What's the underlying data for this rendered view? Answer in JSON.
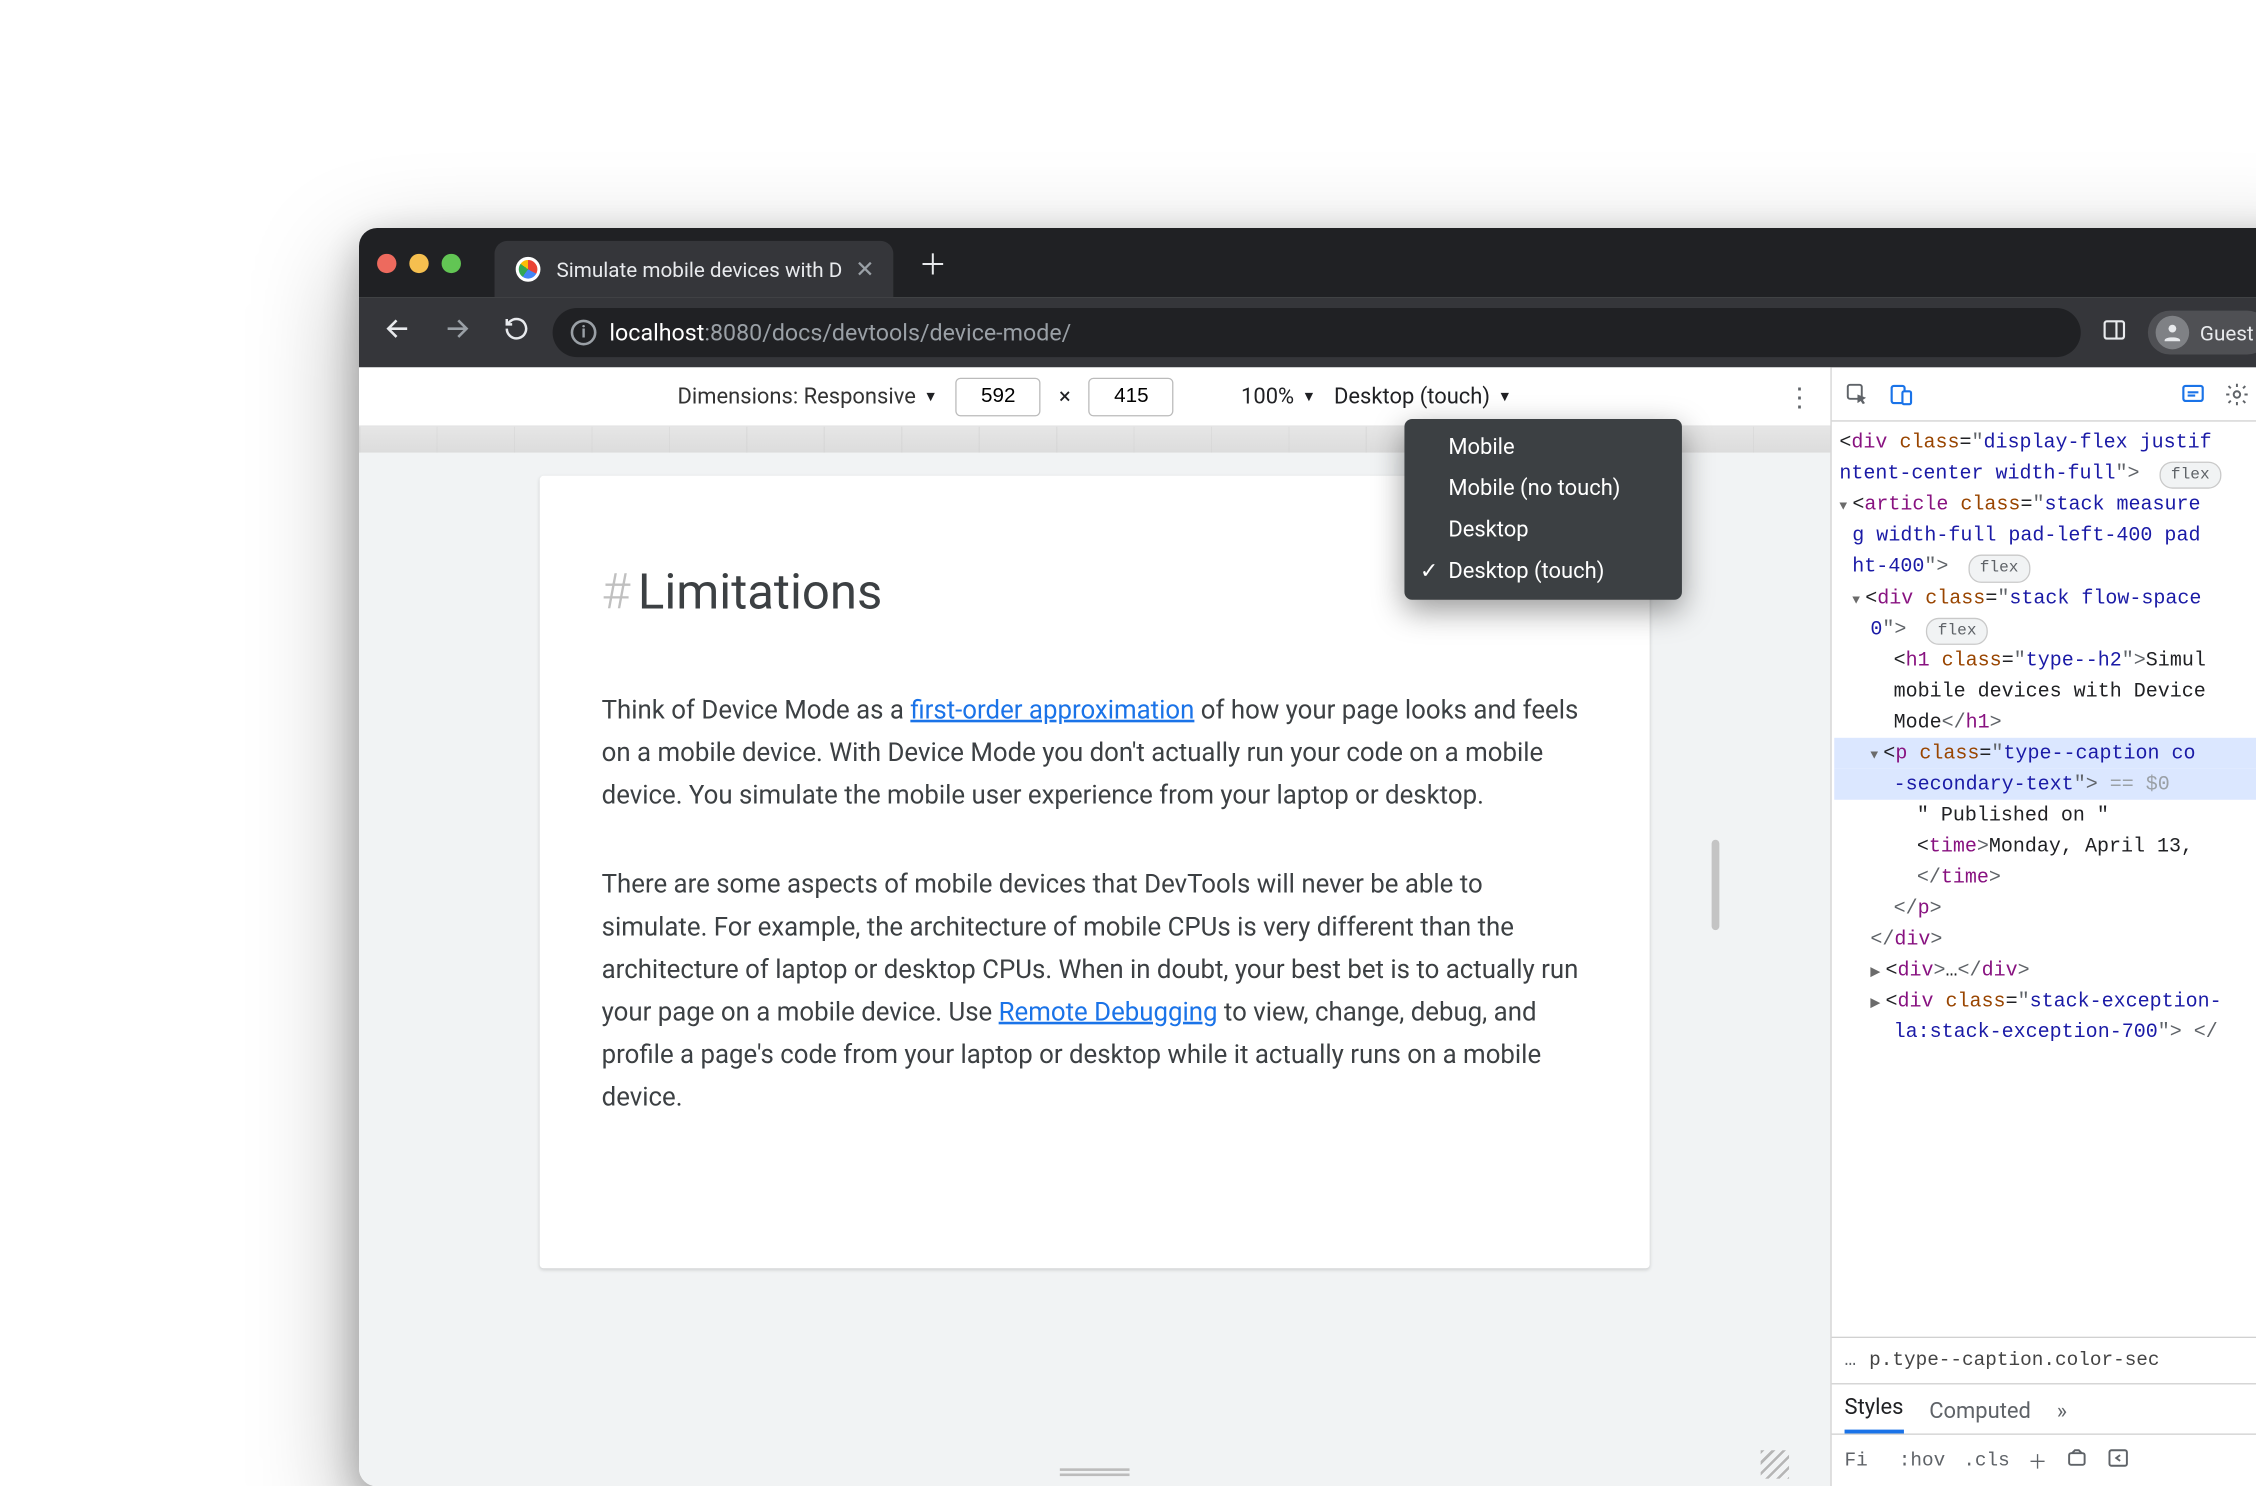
{
  "window": {
    "tab_title": "Simulate mobile devices with D",
    "guest_label": "Guest"
  },
  "omnibox": {
    "host": "localhost",
    "port": ":8080",
    "path": "/docs/devtools/device-mode/"
  },
  "device_toolbar": {
    "dimensions_label": "Dimensions: Responsive",
    "width": "592",
    "height": "415",
    "separator": "×",
    "zoom": "100%",
    "device_type": "Desktop (touch)",
    "menu": {
      "items": [
        "Mobile",
        "Mobile (no touch)",
        "Desktop",
        "Desktop (touch)"
      ],
      "selected_index": 3
    }
  },
  "page": {
    "heading": "Limitations",
    "p1_a": "Think of Device Mode as a ",
    "p1_link": "first-order approximation",
    "p1_b": " of how your page looks and feels on a mobile device. With Device Mode you don't actually run your code on a mobile device. You simulate the mobile user experience from your laptop or desktop.",
    "p2_a": "There are some aspects of mobile devices that DevTools will never be able to simulate. For example, the architecture of mobile CPUs is very different than the architecture of laptop or desktop CPUs. When in doubt, your best bet is to actually run your page on a mobile device. Use ",
    "p2_link": "Remote Debugging",
    "p2_b": " to view, change, debug, and profile a page's code from your laptop or desktop while it actually runs on a mobile device."
  },
  "devtools": {
    "crumb": "p.type--caption.color-sec",
    "tabs": {
      "styles": "Styles",
      "computed": "Computed",
      "more": "»"
    },
    "styles_bar": {
      "filter": "Fi",
      "hov": ":hov",
      "cls": ".cls"
    },
    "dom": {
      "l0": "div",
      "l0_cls": "display-flex justif",
      "l0b": "ntent-center width-full",
      "l1": "article",
      "l1_cls": "stack measure g width-full pad-left-400 pad ht-400",
      "l2": "div",
      "l2_cls": "stack flow-space 0",
      "h1": "h1",
      "h1_cls": "type--h2",
      "h1_text": "Simul mobile devices with Device Mode",
      "p": "p",
      "p_cls": "type--caption co -secondary-text",
      "p_eq": "== $0",
      "pub": "\" Published on \"",
      "time": "time",
      "time_text": "Monday, April 13,",
      "div_excerpt": "div",
      "stack_exc": "stack-exception- la:stack-exception-700"
    }
  }
}
